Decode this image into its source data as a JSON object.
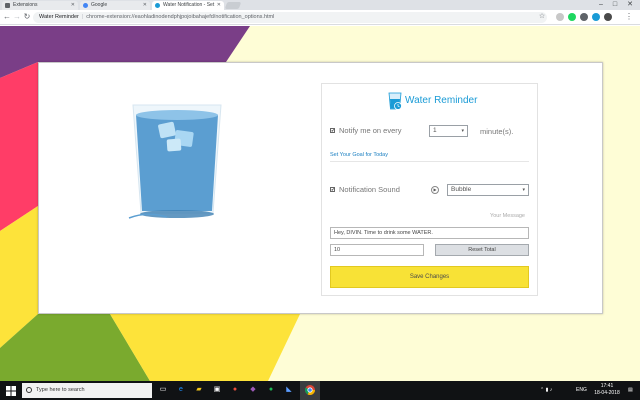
{
  "browser": {
    "tabs": [
      {
        "title": "Extensions",
        "active": false
      },
      {
        "title": "Google",
        "active": false
      },
      {
        "title": "Water Notification - Set",
        "active": true
      }
    ],
    "site_name": "Water Reminder",
    "url": "chrome-extension://eaohladinodendphjpojoibahajefd/notification_options.html",
    "minimize": "–",
    "maximize": "□",
    "close": "✕",
    "back": "←",
    "forward": "→",
    "reload": "↻",
    "star": "☆",
    "menu": "⋮"
  },
  "app": {
    "title": "Water Reminder",
    "notify": {
      "label": "Notify me on every",
      "checked": true,
      "value": "1",
      "unit": "minute(s)."
    },
    "goal_link": "Set Your Goal for Today",
    "sound": {
      "label": "Notification Sound",
      "checked": true,
      "value": "Bubble",
      "play": "▶"
    },
    "message": {
      "label": "Your Message",
      "value": "Hey, DIVIN. Time to drink some WATER."
    },
    "goal_value": "10",
    "reset_label": "Reset Total",
    "save_label": "Save Changes",
    "check_mark": "✔",
    "caret": "▾"
  },
  "taskbar": {
    "search_placeholder": "Type here to search",
    "language": "ENG",
    "time": "17:41",
    "date": "18-04-2018"
  },
  "colors": {
    "accent": "#1a9bd6",
    "save_button": "#f8e236",
    "background_purple": "#7a3e87",
    "background_pink": "#ff3d67",
    "background_cream": "#fefdd6",
    "background_green": "#7aaa2e",
    "background_yellow": "#fde33a"
  }
}
